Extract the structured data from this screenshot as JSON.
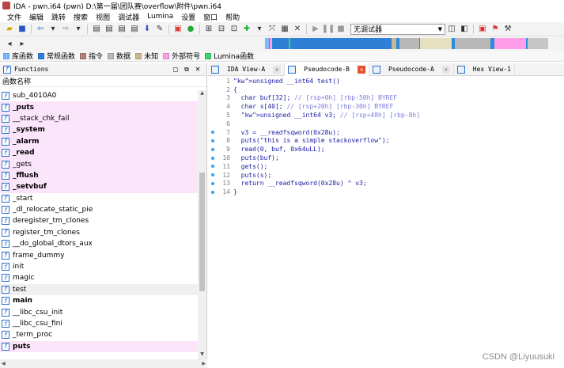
{
  "window": {
    "title": "IDA - pwn.i64 (pwn) D:\\第一届\\团队赛\\overflow\\附件\\pwn.i64"
  },
  "menu": [
    "文件",
    "编辑",
    "跳转",
    "搜索",
    "视图",
    "调试器",
    "Lumina",
    "设置",
    "窗口",
    "帮助"
  ],
  "toolbar": {
    "debugger_select": "无调试器"
  },
  "legend": [
    {
      "label": "库函数",
      "color": "#7fb8ff"
    },
    {
      "label": "常规函数",
      "color": "#2f7fd6"
    },
    {
      "label": "指令",
      "color": "#b08080"
    },
    {
      "label": "数据",
      "color": "#b8b8b8"
    },
    {
      "label": "未知",
      "color": "#c8b890"
    },
    {
      "label": "外部符号",
      "color": "#ff9de8"
    },
    {
      "label": "Lumina函数",
      "color": "#3bd36a"
    }
  ],
  "functions_pane": {
    "title": "Functions",
    "column_header": "函数名称",
    "items": [
      {
        "name": "sub_4010A0",
        "bold": false,
        "pink": false,
        "selected": false
      },
      {
        "name": "_puts",
        "bold": true,
        "pink": true,
        "selected": false
      },
      {
        "name": "__stack_chk_fail",
        "bold": false,
        "pink": true,
        "selected": false
      },
      {
        "name": "_system",
        "bold": true,
        "pink": true,
        "selected": false
      },
      {
        "name": "_alarm",
        "bold": true,
        "pink": true,
        "selected": false
      },
      {
        "name": "_read",
        "bold": true,
        "pink": true,
        "selected": false
      },
      {
        "name": "_gets",
        "bold": false,
        "pink": true,
        "selected": false
      },
      {
        "name": "_fflush",
        "bold": true,
        "pink": true,
        "selected": false
      },
      {
        "name": "_setvbuf",
        "bold": true,
        "pink": true,
        "selected": false
      },
      {
        "name": "_start",
        "bold": false,
        "pink": false,
        "selected": false
      },
      {
        "name": "_dl_relocate_static_pie",
        "bold": false,
        "pink": false,
        "selected": false
      },
      {
        "name": "deregister_tm_clones",
        "bold": false,
        "pink": false,
        "selected": false
      },
      {
        "name": "register_tm_clones",
        "bold": false,
        "pink": false,
        "selected": false
      },
      {
        "name": "__do_global_dtors_aux",
        "bold": false,
        "pink": false,
        "selected": false
      },
      {
        "name": "frame_dummy",
        "bold": false,
        "pink": false,
        "selected": false
      },
      {
        "name": "init",
        "bold": false,
        "pink": false,
        "selected": false
      },
      {
        "name": "magic",
        "bold": false,
        "pink": false,
        "selected": false
      },
      {
        "name": "test",
        "bold": false,
        "pink": false,
        "selected": true
      },
      {
        "name": "main",
        "bold": true,
        "pink": false,
        "selected": false
      },
      {
        "name": "__libc_csu_init",
        "bold": false,
        "pink": false,
        "selected": false
      },
      {
        "name": "__libc_csu_fini",
        "bold": false,
        "pink": false,
        "selected": false
      },
      {
        "name": "_term_proc",
        "bold": false,
        "pink": false,
        "selected": false
      },
      {
        "name": "puts",
        "bold": true,
        "pink": true,
        "selected": false
      }
    ]
  },
  "tabs": [
    {
      "label": "IDA View-A",
      "active": false
    },
    {
      "label": "Pseudocode-B",
      "active": true
    },
    {
      "label": "Pseudocode-A",
      "active": false
    },
    {
      "label": "Hex View-1",
      "active": false
    }
  ],
  "code": [
    {
      "n": "1",
      "dot": false,
      "text": "unsigned __int64 test()"
    },
    {
      "n": "2",
      "dot": false,
      "text": "{"
    },
    {
      "n": "3",
      "dot": false,
      "text": "  char buf[32]; // [rsp+0h] [rbp-50h] BYREF"
    },
    {
      "n": "4",
      "dot": false,
      "text": "  char s[40]; // [rsp+20h] [rbp-30h] BYREF"
    },
    {
      "n": "5",
      "dot": false,
      "text": "  unsigned __int64 v3; // [rsp+48h] [rbp-8h]"
    },
    {
      "n": "6",
      "dot": false,
      "text": ""
    },
    {
      "n": "7",
      "dot": true,
      "text": "  v3 = __readfsqword(0x28u);"
    },
    {
      "n": "8",
      "dot": true,
      "text": "  puts(\"this is a simple stackoverflow\");"
    },
    {
      "n": "9",
      "dot": true,
      "text": "  read(0, buf, 0x64uLL);"
    },
    {
      "n": "10",
      "dot": true,
      "text": "  puts(buf);"
    },
    {
      "n": "11",
      "dot": true,
      "text": "  gets();"
    },
    {
      "n": "12",
      "dot": true,
      "text": "  puts(s);"
    },
    {
      "n": "13",
      "dot": true,
      "text": "  return __readfsqword(0x28u) ^ v3;"
    },
    {
      "n": "14",
      "dot": true,
      "text": "}"
    }
  ],
  "watermark": "CSDN @Liyuusuki"
}
